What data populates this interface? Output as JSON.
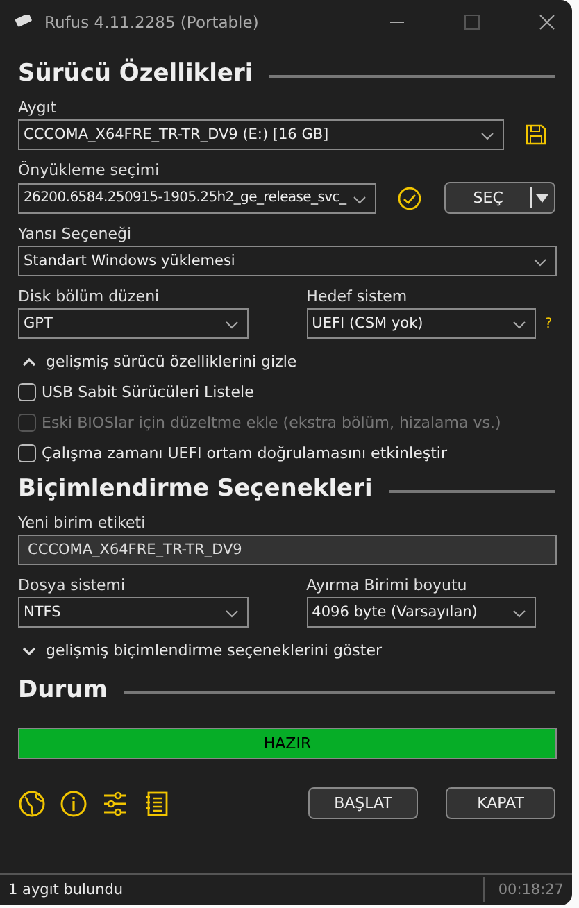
{
  "window": {
    "title": "Rufus 4.11.2285 (Portable)"
  },
  "drive": {
    "heading": "Sürücü Özellikleri",
    "device": {
      "label": "Aygıt",
      "value": "CCCOMA_X64FRE_TR-TR_DV9 (E:) [16 GB]"
    },
    "boot": {
      "label": "Önyükleme seçimi",
      "value": "26200.6584.250915-1905.25h2_ge_release_svc_",
      "select_button": "SEÇ"
    },
    "image_option": {
      "label": "Yansı Seçeneği",
      "value": "Standart Windows yüklemesi"
    },
    "partition": {
      "label": "Disk bölüm düzeni",
      "value": "GPT"
    },
    "target": {
      "label": "Hedef sistem",
      "value": "UEFI (CSM yok)",
      "help": "?"
    },
    "advanced_toggle": {
      "label": "gelişmiş sürücü özelliklerini gizle",
      "expanded": true
    },
    "options": [
      {
        "label": "USB Sabit Sürücüleri Listele",
        "checked": false,
        "disabled": false
      },
      {
        "label": "Eski BIOSlar için düzeltme ekle (ekstra bölüm, hizalama vs.)",
        "checked": false,
        "disabled": true
      },
      {
        "label": "Çalışma zamanı UEFI ortam doğrulamasını etkinleştir",
        "checked": false,
        "disabled": false
      }
    ]
  },
  "format": {
    "heading": "Biçimlendirme Seçenekleri",
    "volume_label": {
      "label": "Yeni birim etiketi",
      "value": "CCCOMA_X64FRE_TR-TR_DV9"
    },
    "filesystem": {
      "label": "Dosya sistemi",
      "value": "NTFS"
    },
    "cluster": {
      "label": "Ayırma Birimi boyutu",
      "value": "4096 byte (Varsayılan)"
    },
    "advanced_toggle": {
      "label": "gelişmiş biçimlendirme seçeneklerini göster",
      "expanded": false
    }
  },
  "status": {
    "heading": "Durum",
    "progress": {
      "text": "HAZIR",
      "level": 1
    }
  },
  "buttons": [
    "BAŞLAT",
    "KAPAT"
  ],
  "status_bar": {
    "message": "1 aygıt bulundu",
    "time": "00:18:27"
  }
}
